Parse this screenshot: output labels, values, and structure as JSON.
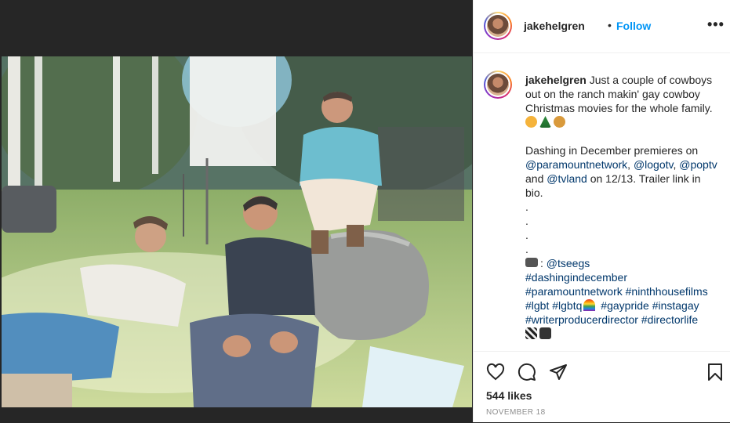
{
  "post": {
    "username": "jakehelgren",
    "separator": "•",
    "follow_label": "Follow",
    "more_label": "•••"
  },
  "caption": {
    "username": "jakehelgren",
    "line1": "Just a couple of cowboys out on the ranch makin' gay cowboy Christmas movies for the whole family.",
    "emoji_line": [
      "smiling-face-with-hearts",
      "christmas-tree",
      "cowboy-face"
    ],
    "p2_text_a": "Dashing in December premieres on",
    "mention1": "@paramountnetwork",
    "sep1": ",",
    "mention2": "@logotv",
    "sep2": ",",
    "mention3": "@poptv",
    "p2_and": "and",
    "mention4": "@tvland",
    "p2_text_b": "on 12/13. Trailer link in bio.",
    "dots": [
      ".",
      ".",
      ".",
      "."
    ],
    "camera_label": ":",
    "credit": "@tseegs",
    "tags": {
      "t1": "#dashingindecember",
      "t2": "#paramountnetwork",
      "t3": "#ninthhousefilms",
      "t4": "#lgbt",
      "t5": "#lgbtq",
      "t6": "#gaypride",
      "t7": "#instagay",
      "t8": "#writerproducerdirector",
      "t9": "#directorlife"
    },
    "end_emoji": [
      "clapper-board",
      "movie-camera"
    ]
  },
  "actions": {
    "icons": [
      "heart-icon",
      "comment-icon",
      "share-icon",
      "bookmark-icon"
    ]
  },
  "likes": "544 likes",
  "date": "NOVEMBER 18",
  "colors": {
    "link": "#00376b",
    "follow": "#0095f6",
    "muted": "#8e8e8e"
  }
}
